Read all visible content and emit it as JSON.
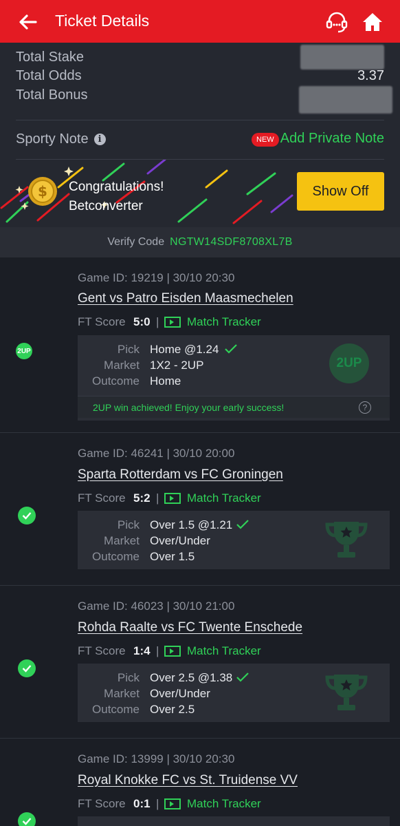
{
  "header": {
    "title": "Ticket Details"
  },
  "summary": {
    "total_stake_label": "Total Stake",
    "total_odds_label": "Total Odds",
    "total_odds_value": "3.37",
    "total_bonus_label": "Total Bonus",
    "sporty_note_label": "Sporty Note",
    "new_badge": "NEW",
    "add_note_label": "Add Private Note"
  },
  "promo": {
    "line1": "Congratulations!",
    "line2": "Betconverter",
    "button_label": "Show Off"
  },
  "verify": {
    "label": "Verify Code",
    "code": "NGTW14SDF8708XL7B"
  },
  "matches": [
    {
      "game_line": "Game ID: 19219 | 30/10 20:30",
      "teams": "Gent vs Patro Eisden Maasmechelen",
      "ft_label": "FT Score",
      "ft_score": "5:0",
      "tracker_label": "Match Tracker",
      "pick_label": "Pick",
      "pick": "Home @1.24",
      "market_label": "Market",
      "market": "1X2 - 2UP",
      "outcome_label": "Outcome",
      "outcome": "Home",
      "status_badge": "2UP",
      "watermark": "2UP",
      "banner": "2UP win achieved! Enjoy your early success!"
    },
    {
      "game_line": "Game ID: 46241 | 30/10 20:00",
      "teams": "Sparta Rotterdam vs FC Groningen",
      "ft_label": "FT Score",
      "ft_score": "5:2",
      "tracker_label": "Match Tracker",
      "pick_label": "Pick",
      "pick": "Over 1.5 @1.21",
      "market_label": "Market",
      "market": "Over/Under",
      "outcome_label": "Outcome",
      "outcome": "Over 1.5"
    },
    {
      "game_line": "Game ID: 46023 | 30/10 21:00",
      "teams": "Rohda Raalte vs FC Twente Enschede",
      "ft_label": "FT Score",
      "ft_score": "1:4",
      "tracker_label": "Match Tracker",
      "pick_label": "Pick",
      "pick": "Over 2.5 @1.38",
      "market_label": "Market",
      "market": "Over/Under",
      "outcome_label": "Outcome",
      "outcome": "Over 2.5"
    },
    {
      "game_line": "Game ID: 13999 | 30/10 20:30",
      "teams": "Royal Knokke FC vs St. Truidense VV",
      "ft_label": "FT Score",
      "ft_score": "0:1",
      "tracker_label": "Match Tracker"
    }
  ],
  "colors": {
    "brand_red": "#e41b23",
    "success_green": "#30d158",
    "button_yellow": "#f5c211",
    "background": "#1b1e25"
  }
}
